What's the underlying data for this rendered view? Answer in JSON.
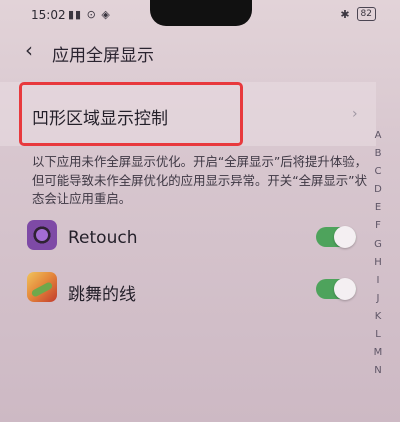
{
  "status_bar": {
    "time": "15:02",
    "left_icons": "▮▮ ⊙ ◈",
    "bluetooth": "✱",
    "battery": "82"
  },
  "header": {
    "back_glyph": "‹",
    "title": "应用全屏显示"
  },
  "notch_setting": {
    "label": "凹形区域显示控制",
    "chevron": "›"
  },
  "note": "以下应用未作全屏显示优化。开启“全屏显示”后将提升体验，但可能导致未作全屏优化的应用显示异常。开关“全屏显示”状态会让应用重启。",
  "apps": [
    {
      "name": "Retouch",
      "enabled": true
    },
    {
      "name": "跳舞的线",
      "enabled": true
    }
  ],
  "alphabet_index": [
    "A",
    "B",
    "C",
    "D",
    "E",
    "F",
    "G",
    "H",
    "I",
    "J",
    "K",
    "L",
    "M",
    "N"
  ],
  "colors": {
    "highlight": "#e8393d",
    "toggle_on": "#4ea35c",
    "background": "#d9c8cf"
  }
}
